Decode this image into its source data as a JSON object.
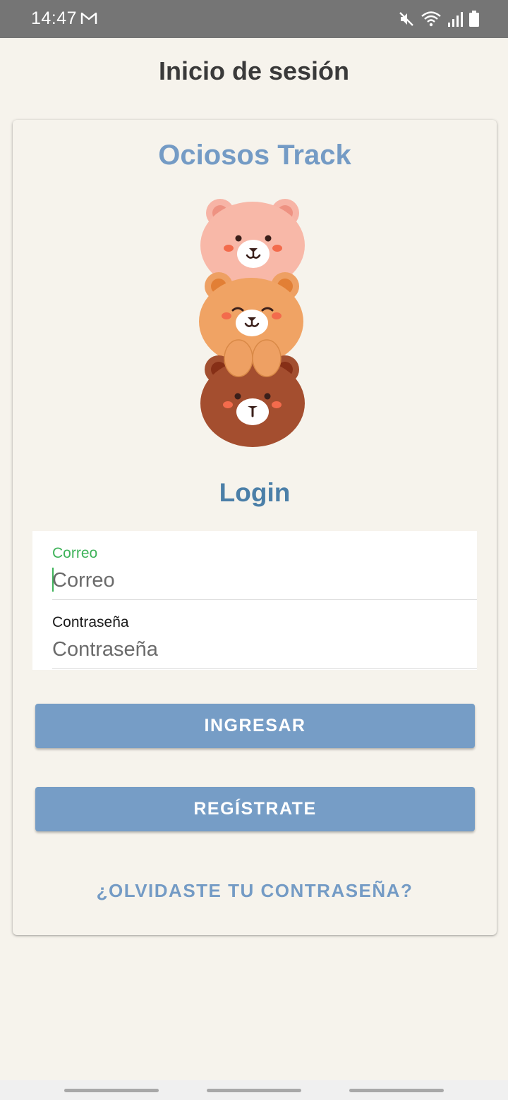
{
  "status_bar": {
    "time": "14:47",
    "icons": [
      "gmail-icon",
      "mute-icon",
      "wifi-icon",
      "signal-icon",
      "battery-icon"
    ]
  },
  "header": {
    "title": "Inicio de sesión"
  },
  "card": {
    "app_name": "Ociosos Track",
    "login_heading": "Login",
    "email": {
      "label": "Correo",
      "placeholder": "Correo",
      "value": ""
    },
    "password": {
      "label": "Contraseña",
      "placeholder": "Contraseña",
      "value": ""
    },
    "login_button": "INGRESAR",
    "register_button": "REGÍSTRATE",
    "forgot_link": "¿OLVIDASTE TU CONTRASEÑA?"
  },
  "colors": {
    "background": "#f6f3ec",
    "accent": "#769dc6",
    "heading_blue": "#4b7fa8",
    "focus_green": "#3fb35a",
    "status_bar": "#757575"
  }
}
